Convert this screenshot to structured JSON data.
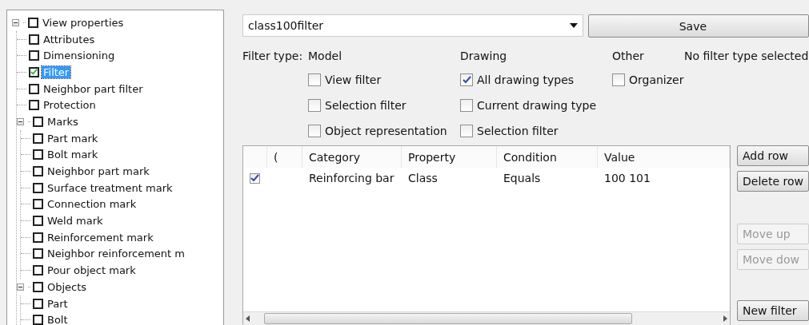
{
  "tree": [
    {
      "label": "View properties",
      "checked": false,
      "selected": false,
      "expanded": true,
      "children": [
        {
          "label": "Attributes",
          "checked": false,
          "selected": false
        },
        {
          "label": "Dimensioning",
          "checked": false,
          "selected": false
        },
        {
          "label": "Filter",
          "checked": true,
          "selected": true
        },
        {
          "label": "Neighbor part filter",
          "checked": false,
          "selected": false
        },
        {
          "label": "Protection",
          "checked": false,
          "selected": false
        },
        {
          "label": "Marks",
          "checked": false,
          "selected": false,
          "expanded": true,
          "children": [
            {
              "label": "Part mark",
              "checked": false,
              "selected": false
            },
            {
              "label": "Bolt mark",
              "checked": false,
              "selected": false
            },
            {
              "label": "Neighbor part mark",
              "checked": false,
              "selected": false
            },
            {
              "label": "Surface treatment mark",
              "checked": false,
              "selected": false
            },
            {
              "label": "Connection mark",
              "checked": false,
              "selected": false
            },
            {
              "label": "Weld mark",
              "checked": false,
              "selected": false
            },
            {
              "label": "Reinforcement mark",
              "checked": false,
              "selected": false
            },
            {
              "label": "Neighbor reinforcement m",
              "checked": false,
              "selected": false
            },
            {
              "label": "Pour object mark",
              "checked": false,
              "selected": false
            }
          ]
        },
        {
          "label": "Objects",
          "checked": false,
          "selected": false,
          "expanded": true,
          "children": [
            {
              "label": "Part",
              "checked": false,
              "selected": false
            },
            {
              "label": "Bolt",
              "checked": false,
              "selected": false
            }
          ]
        }
      ]
    }
  ],
  "filter_name": {
    "value": "class100filter"
  },
  "save_button": "Save",
  "filter_type": {
    "label": "Filter type:",
    "status": "No filter type selected",
    "groups": [
      {
        "title": "Model",
        "options": [
          {
            "label": "View filter",
            "checked": false
          },
          {
            "label": "Selection filter",
            "checked": false
          },
          {
            "label": "Object representation",
            "checked": false
          }
        ]
      },
      {
        "title": "Drawing",
        "options": [
          {
            "label": "All drawing types",
            "checked": true
          },
          {
            "label": "Current drawing type",
            "checked": false
          },
          {
            "label": "Selection filter",
            "checked": false
          }
        ]
      },
      {
        "title": "Other",
        "options": [
          {
            "label": "Organizer",
            "checked": false
          }
        ]
      }
    ]
  },
  "table": {
    "columns": [
      "(",
      "Category",
      "Property",
      "Condition",
      "Value"
    ],
    "rows": [
      {
        "checked": true,
        "cells": [
          "",
          "Reinforcing bar",
          "Class",
          "Equals",
          "100 101"
        ]
      }
    ]
  },
  "side_buttons": [
    {
      "label": "Add row",
      "disabled": false
    },
    {
      "label": "Delete row",
      "disabled": false
    },
    {
      "label": "Move up",
      "disabled": true
    },
    {
      "label": "Move dow",
      "disabled": true
    },
    {
      "label": "New filter",
      "disabled": false
    }
  ]
}
